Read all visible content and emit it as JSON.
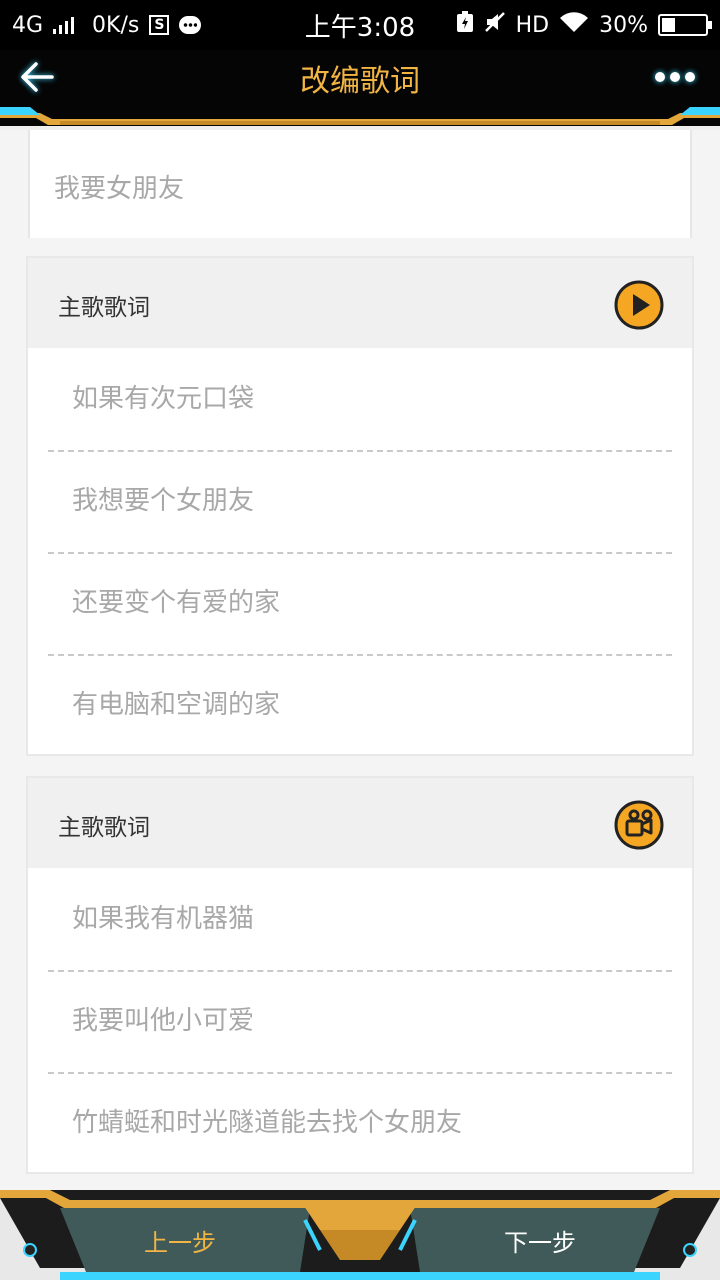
{
  "status_bar": {
    "network": "4G",
    "speed": "0K/s",
    "sim_label": "S",
    "time": "上午3:08",
    "hd": "HD",
    "battery": "30%",
    "battery_level": 0.3
  },
  "header": {
    "title": "改编歌词",
    "back_icon": "arrow-left-icon",
    "more_icon": "more-dots-icon"
  },
  "top_card": {
    "text": "我要女朋友"
  },
  "sections": [
    {
      "title": "主歌歌词",
      "icon": "play-icon",
      "lines": [
        "如果有次元口袋",
        "我想要个女朋友",
        "还要变个有爱的家",
        "有电脑和空调的家"
      ]
    },
    {
      "title": "主歌歌词",
      "icon": "record-icon",
      "lines": [
        "如果我有机器猫",
        "我要叫他小可爱",
        "竹蜻蜓和时光隧道能去找个女朋友"
      ]
    }
  ],
  "footer": {
    "prev_label": "上一步",
    "next_label": "下一步"
  },
  "colors": {
    "accent": "#f2b544",
    "icon_fill": "#f5a623",
    "header_bg": "#050505",
    "glow": "#3ad4ff"
  }
}
